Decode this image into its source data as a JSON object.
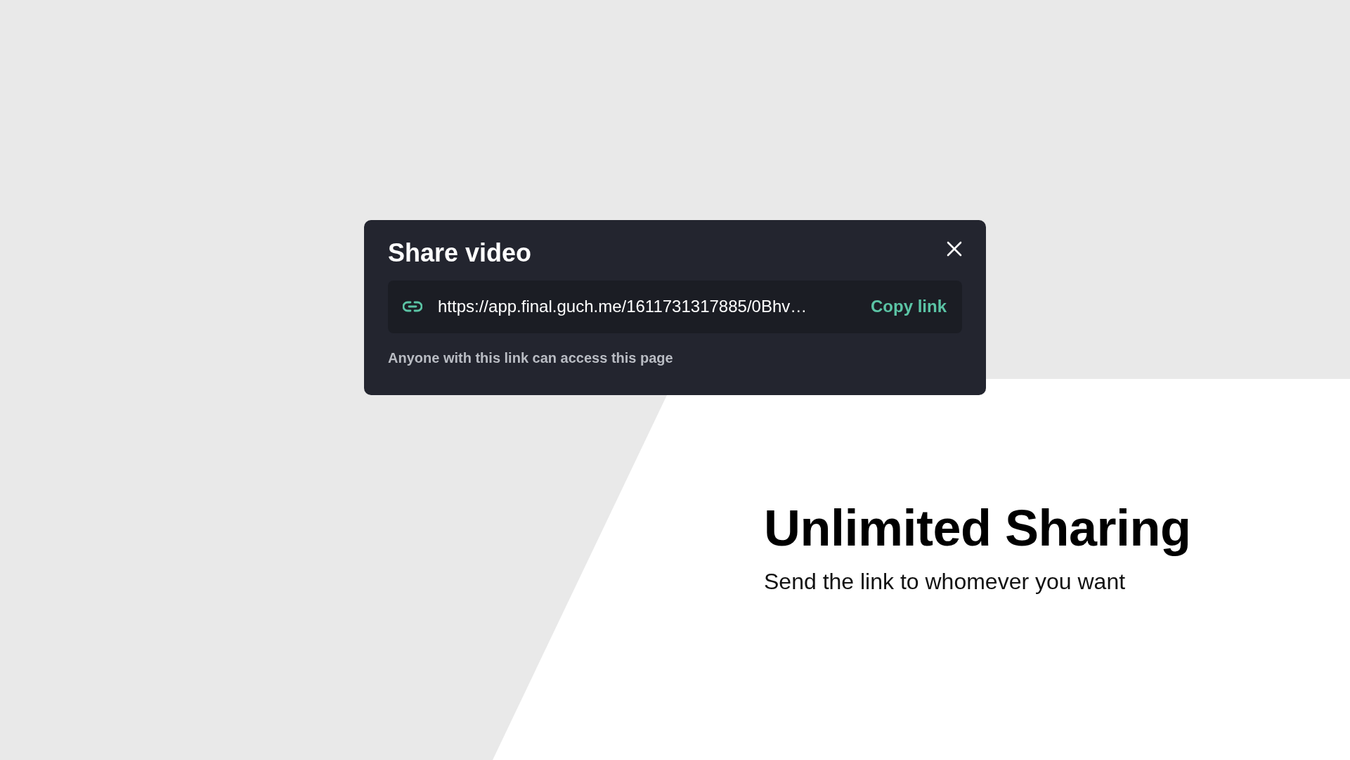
{
  "dialog": {
    "title": "Share video",
    "link": {
      "url": "https://app.final.guch.me/1611731317885/0Bhv…",
      "action": "Copy link"
    },
    "note": "Anyone with this link can access this page"
  },
  "headline": "Unlimited Sharing",
  "subheadline": "Send the link to whomever you want"
}
